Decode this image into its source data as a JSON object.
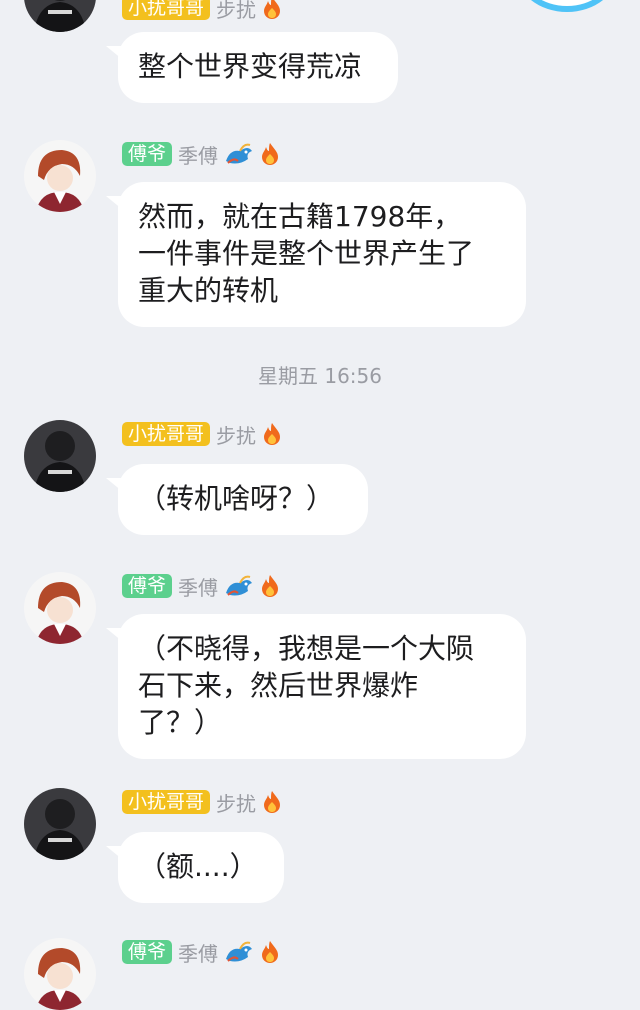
{
  "messages": [
    {
      "type": "msg",
      "user": "xiaorao",
      "tag": "小扰哥哥",
      "nick": "步扰",
      "lines": [
        "整个世界变得荒凉"
      ]
    },
    {
      "type": "msg",
      "user": "fuye",
      "tag": "傅爷",
      "nick": "季傅",
      "lines": [
        "然而，就在古籍1798年，",
        "一件事件是整个世界产生了",
        "重大的转机"
      ]
    },
    {
      "type": "time",
      "text": "星期五 16:56"
    },
    {
      "type": "msg",
      "user": "xiaorao",
      "tag": "小扰哥哥",
      "nick": "步扰",
      "lines": [
        "（转机啥呀？）"
      ]
    },
    {
      "type": "msg",
      "user": "fuye",
      "tag": "傅爷",
      "nick": "季傅",
      "lines": [
        "（不晓得，我想是一个大陨",
        "石下来，然后世界爆炸",
        "了？）"
      ]
    },
    {
      "type": "msg",
      "user": "xiaorao",
      "tag": "小扰哥哥",
      "nick": "步扰",
      "lines": [
        "（额....）"
      ]
    },
    {
      "type": "msg",
      "user": "fuye",
      "tag": "傅爷",
      "nick": "季傅",
      "lines": []
    }
  ],
  "colors": {
    "background": "#eef0f4",
    "tag_yellow": "#f3c01e",
    "tag_green": "#5cd08d",
    "nick_gray": "#9a9ca3",
    "bubble": "#ffffff"
  },
  "icons": {
    "flame": "flame-icon",
    "dragon": "dragon-icon",
    "avatar_xiaorao": "avatar-dark-hoodie",
    "avatar_fuye": "avatar-red-hair"
  }
}
